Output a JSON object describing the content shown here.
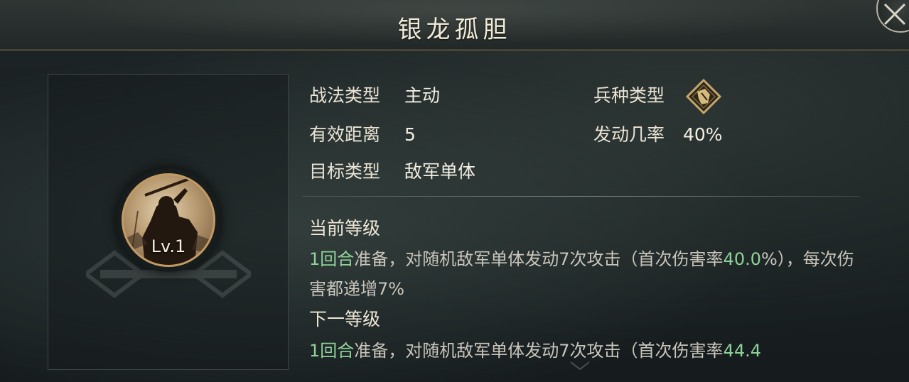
{
  "header": {
    "title": "银龙孤胆"
  },
  "skill": {
    "level": "Lv.1"
  },
  "info": {
    "type_label": "战法类型",
    "type_value": "主动",
    "troop_label": "兵种类型",
    "troop_icon": "cavalry-icon",
    "range_label": "有效距离",
    "range_value": "5",
    "rate_label": "发动几率",
    "rate_value": "40%",
    "target_label": "目标类型",
    "target_value": "敌军单体"
  },
  "current": {
    "title": "当前等级",
    "prep": "1回合",
    "text1": "准备，对随机敌军单体发动7次攻击（首次伤害率",
    "dmg": "40.0",
    "text2": "%），每次伤害都递增7%"
  },
  "next": {
    "title": "下一等级",
    "prep": "1回合",
    "text1": "准备，对随机敌军单体发动7次攻击（首次伤害率",
    "dmg": "44.4"
  },
  "colors": {
    "accent_gold": "#b69d6a",
    "highlight_green": "#8ed39a"
  }
}
